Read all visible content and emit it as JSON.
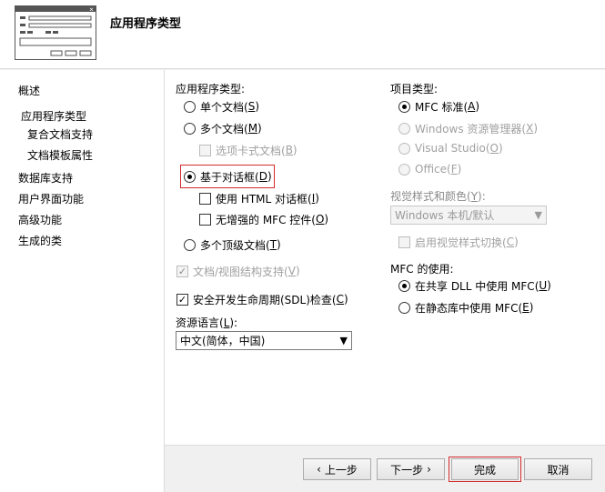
{
  "header": {
    "title": "应用程序类型"
  },
  "sidebar": {
    "items": [
      {
        "label": "概述"
      },
      {
        "label": "应用程序类型"
      },
      {
        "label": "复合文档支持"
      },
      {
        "label": "文档模板属性"
      },
      {
        "label": "数据库支持"
      },
      {
        "label": "用户界面功能"
      },
      {
        "label": "高级功能"
      },
      {
        "label": "生成的类"
      }
    ]
  },
  "app_type": {
    "label": "应用程序类型:",
    "single_doc": {
      "text": "单个文档(",
      "key": "S",
      "end": ")"
    },
    "multi_doc": {
      "text": "多个文档(",
      "key": "M",
      "end": ")"
    },
    "tabbed_doc": {
      "text": "选项卡式文档(",
      "key": "B",
      "end": ")"
    },
    "dialog_based": {
      "text": "基于对话框(",
      "key": "D",
      "end": ")"
    },
    "use_html_dialog": {
      "text": "使用 HTML 对话框(",
      "key": "I",
      "end": ")"
    },
    "no_enhanced_mfc": {
      "text": "无增强的 MFC 控件(",
      "key": "O",
      "end": ")"
    },
    "multi_top_doc": {
      "text": "多个顶级文档(",
      "key": "T",
      "end": ")"
    },
    "doc_view": {
      "text": "文档/视图结构支持(",
      "key": "V",
      "end": ")"
    },
    "sdl": {
      "text": "安全开发生命周期(SDL)检查(",
      "key": "C",
      "end": ")"
    }
  },
  "resource_lang": {
    "label": {
      "text": "资源语言(",
      "key": "L",
      "end": "):"
    },
    "value": "中文(简体，中国)"
  },
  "project_type": {
    "label": "项目类型:",
    "mfc_standard": {
      "text": "MFC 标准(",
      "key": "A",
      "end": ")"
    },
    "explorer": {
      "text": "Windows 资源管理器(",
      "key": "X",
      "end": ")"
    },
    "visual_studio": {
      "text": "Visual Studio(",
      "key": "O",
      "end": ")"
    },
    "office": {
      "text": "Office(",
      "key": "F",
      "end": ")"
    }
  },
  "visual_style": {
    "label": {
      "text": "视觉样式和颜色(",
      "key": "Y",
      "end": "):"
    },
    "value": "Windows 本机/默认",
    "toggle": {
      "text": "启用视觉样式切换(",
      "key": "C",
      "end": ")"
    }
  },
  "mfc_use": {
    "label": "MFC 的使用:",
    "shared": {
      "text": "在共享 DLL 中使用 MFC(",
      "key": "U",
      "end": ")"
    },
    "static": {
      "text": "在静态库中使用 MFC(",
      "key": "E",
      "end": ")"
    }
  },
  "footer": {
    "prev": "上一步",
    "next": "下一步",
    "finish": "完成",
    "cancel": "取消"
  },
  "colors": {
    "highlight": "#d42a2a"
  }
}
